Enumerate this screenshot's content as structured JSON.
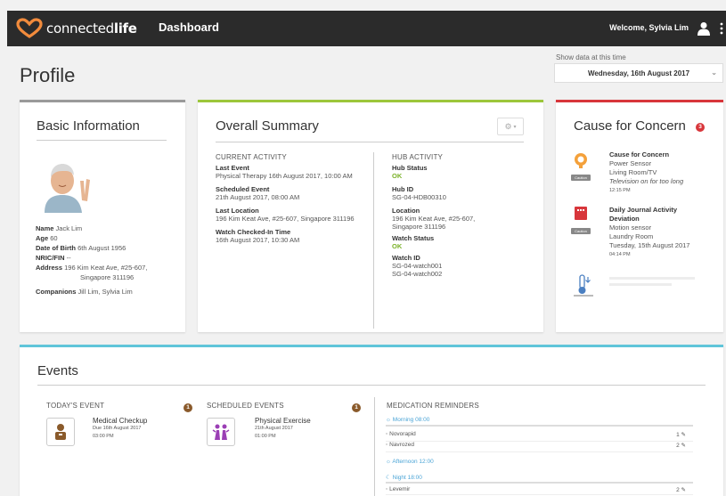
{
  "topbar": {
    "brand_light": "connected",
    "brand_bold": "life",
    "nav": "Dashboard",
    "welcome": "Welcome, Sylvia Lim"
  },
  "header": {
    "title": "Profile",
    "show_label": "Show data at this time",
    "date_value": "Wednesday, 16th August 2017"
  },
  "basic": {
    "title": "Basic Information",
    "fields": [
      {
        "label": "Name",
        "value": "Jack Lim"
      },
      {
        "label": "Age",
        "value": "60"
      },
      {
        "label": "Date of Birth",
        "value": "6th August 1956"
      },
      {
        "label": "NRIC/FIN",
        "value": "--"
      },
      {
        "label": "Address",
        "value": "196 Kim Keat Ave, #25-607,"
      },
      {
        "label": "",
        "value": "Singapore 311196"
      },
      {
        "label": "Companions",
        "value": "Jill Lim, Sylvia Lim"
      }
    ]
  },
  "summary": {
    "title": "Overall Summary",
    "current": {
      "heading": "CURRENT ACTIVITY",
      "items": [
        {
          "label": "Last Event",
          "value": "Physical Therapy 16th August 2017, 10:00 AM"
        },
        {
          "label": "Scheduled Event",
          "value": "21th August 2017, 08:00 AM"
        },
        {
          "label": "Last Location",
          "value": "196 Kim Keat Ave, #25-607, Singapore 311196"
        },
        {
          "label": "Watch Checked-In Time",
          "value": "16th August 2017, 10:30 AM"
        }
      ]
    },
    "hub": {
      "heading": "HUB ACTIVITY",
      "hub_status_label": "Hub Status",
      "hub_status": "OK",
      "hub_id_label": "Hub ID",
      "hub_id": "SG-04-HDB00310",
      "location_label": "Location",
      "location_1": "196 Kim Keat Ave, #25-607,",
      "location_2": "Singapore 311196",
      "watch_status_label": "Watch Status",
      "watch_status": "OK",
      "watch_id_label": "Watch ID",
      "watch_id_1": "SG-04-watch001",
      "watch_id_2": "SG-04-watch002"
    }
  },
  "concern": {
    "title": "Cause for Concern",
    "count": "3",
    "items": [
      {
        "title": "Cause for Concern",
        "l1": "Power Sensor",
        "l2": "Living Room/TV",
        "l3": "Television on for too long",
        "time": "12:15 PM",
        "tag": "Caution"
      },
      {
        "title": "Daily Journal Activity",
        "title2": "Deviation",
        "l1": "Motion sensor",
        "l2": "Laundry Room",
        "l3": "Tuesday, 15th August 2017",
        "time": "04:14 PM",
        "tag": "Caution"
      }
    ]
  },
  "events": {
    "title": "Events",
    "today": {
      "heading": "TODAY'S EVENT",
      "count": "1",
      "name": "Medical Checkup",
      "due": "Due 16th August 2017",
      "time": "03:00 PM"
    },
    "scheduled": {
      "heading": "SCHEDULED EVENTS",
      "count": "1",
      "name": "Physical Exercise",
      "date": "21th August 2017",
      "time": "01:00 PM"
    },
    "meds": {
      "heading": "MEDICATION REMINDERS",
      "morning": "Morning",
      "morning_time": "08:00",
      "items_morning": [
        {
          "name": "Novorapid",
          "qty": "1"
        },
        {
          "name": "Navrozed",
          "qty": "2"
        }
      ],
      "afternoon": "Afternoon",
      "afternoon_time": "12:00",
      "night": "Night",
      "night_time": "18:00",
      "items_night": [
        {
          "name": "Levemir",
          "qty": "2"
        }
      ]
    }
  },
  "colors": {
    "basic": "#9a9a9a",
    "summary": "#9cc63b",
    "concern": "#d8363b",
    "events": "#5fc5d9",
    "ok": "#7bb22a",
    "badge_concern": "#d8363b",
    "badge_event": "#8a5a2b",
    "logo": "#f28b3c"
  }
}
